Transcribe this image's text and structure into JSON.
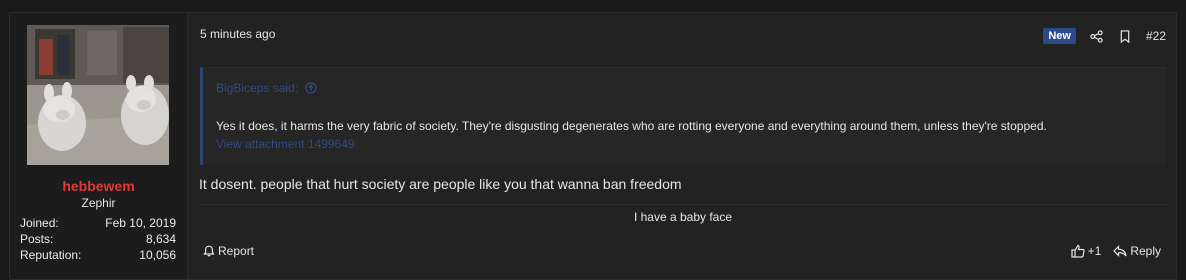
{
  "user": {
    "name": "hebbewem",
    "title": "Zephir",
    "stats": [
      {
        "label": "Joined:",
        "value": "Feb 10, 2019"
      },
      {
        "label": "Posts:",
        "value": "8,634"
      },
      {
        "label": "Reputation:",
        "value": "10,056"
      }
    ]
  },
  "post": {
    "time": "5 minutes ago",
    "badge": "New",
    "number": "#22",
    "quote": {
      "author_said": "BigBiceps said:",
      "text": "Yes it does, it harms the very fabric of society. They're disgusting degenerates who are rotting everyone and everything around them, unless they're stopped.",
      "attachment_link": "View attachment 1499649"
    },
    "content": "It dosent. people that hurt society are people like you that wanna ban freedom",
    "signature": "I have a baby face"
  },
  "footer": {
    "report_label": "Report",
    "reaction_count": "+1",
    "reply_label": "Reply"
  },
  "colors": {
    "username": "#e03a3a",
    "badge_new_bg": "#2c4a8a",
    "quote_link": "#2f4a86"
  },
  "icons": [
    "share-icon",
    "bookmark-icon",
    "report-icon",
    "thumbs-up-icon",
    "reply-icon",
    "quote-arrow-icon"
  ]
}
